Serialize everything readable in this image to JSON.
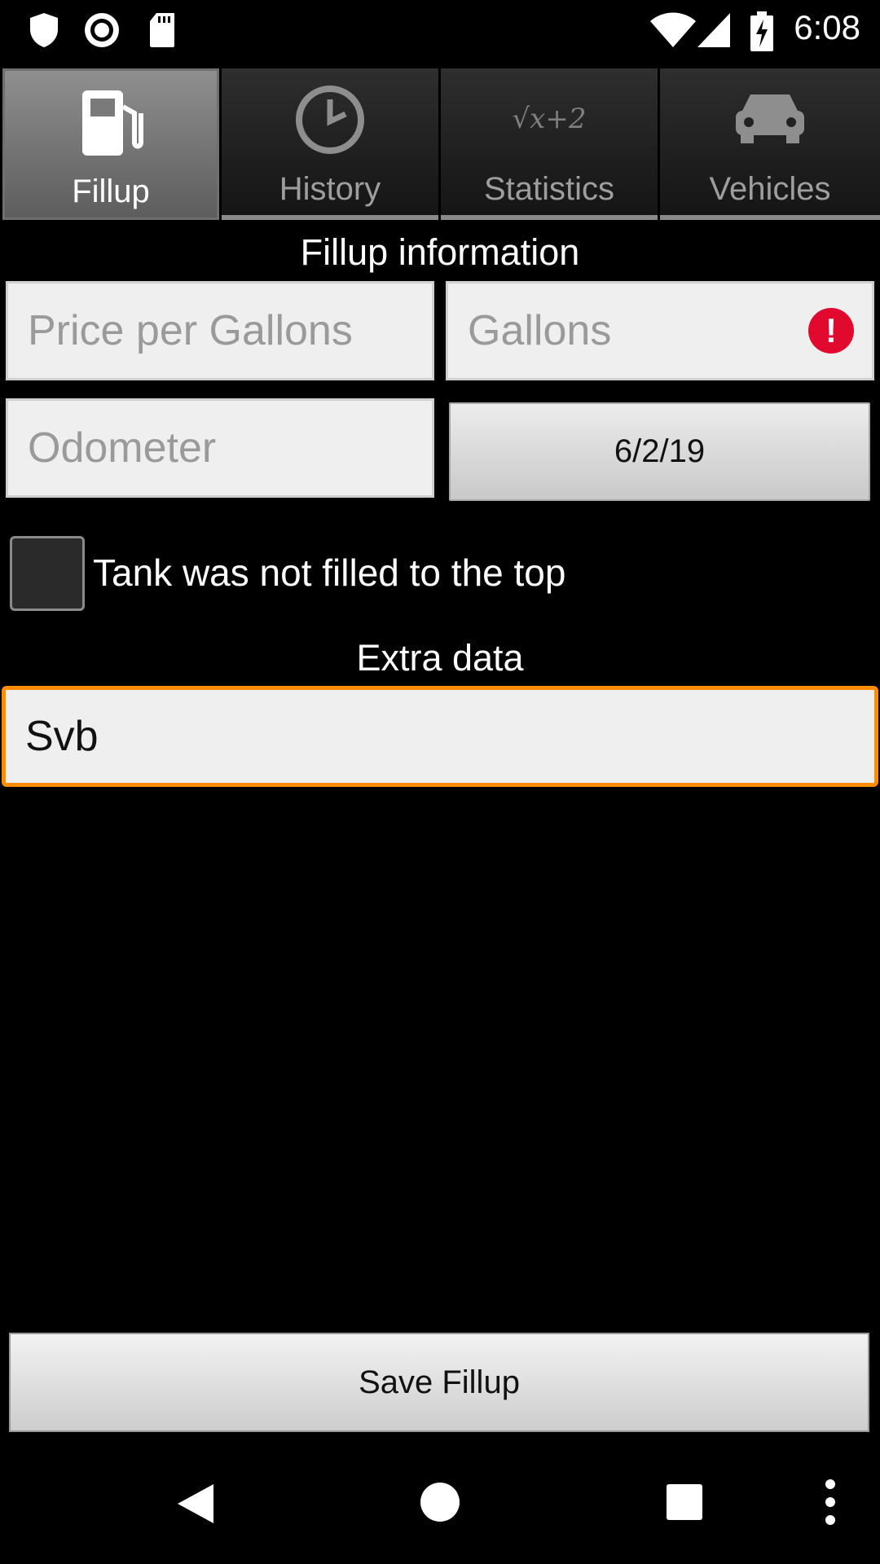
{
  "status_bar": {
    "time": "6:08",
    "left_icons": [
      "shield-icon",
      "record-icon",
      "sd-card-icon"
    ],
    "right_icons": [
      "wifi-icon",
      "cell-signal-icon",
      "battery-charging-icon"
    ]
  },
  "tabs": [
    {
      "label": "Fillup",
      "icon": "fuel-pump-icon",
      "active": true
    },
    {
      "label": "History",
      "icon": "clock-icon",
      "active": false
    },
    {
      "label": "Statistics",
      "icon": "formula-icon",
      "active": false
    },
    {
      "label": "Vehicles",
      "icon": "car-icon",
      "active": false
    }
  ],
  "statistics_icon_text": "√x+2",
  "form": {
    "title": "Fillup information",
    "price_placeholder": "Price per Gallons",
    "gallons_placeholder": "Gallons",
    "gallons_error": true,
    "odometer_placeholder": "Odometer",
    "date": "6/2/19",
    "partial_fill_label": "Tank was not filled to the top",
    "partial_fill_checked": false,
    "extra_title": "Extra data",
    "extra_value": "Svb",
    "save_label": "Save Fillup"
  },
  "nav_bar": [
    "back-icon",
    "home-icon",
    "recents-icon",
    "overflow-menu-icon"
  ],
  "colors": {
    "focus_border": "#ff8c00",
    "error": "#e2092f",
    "background": "#000000"
  }
}
